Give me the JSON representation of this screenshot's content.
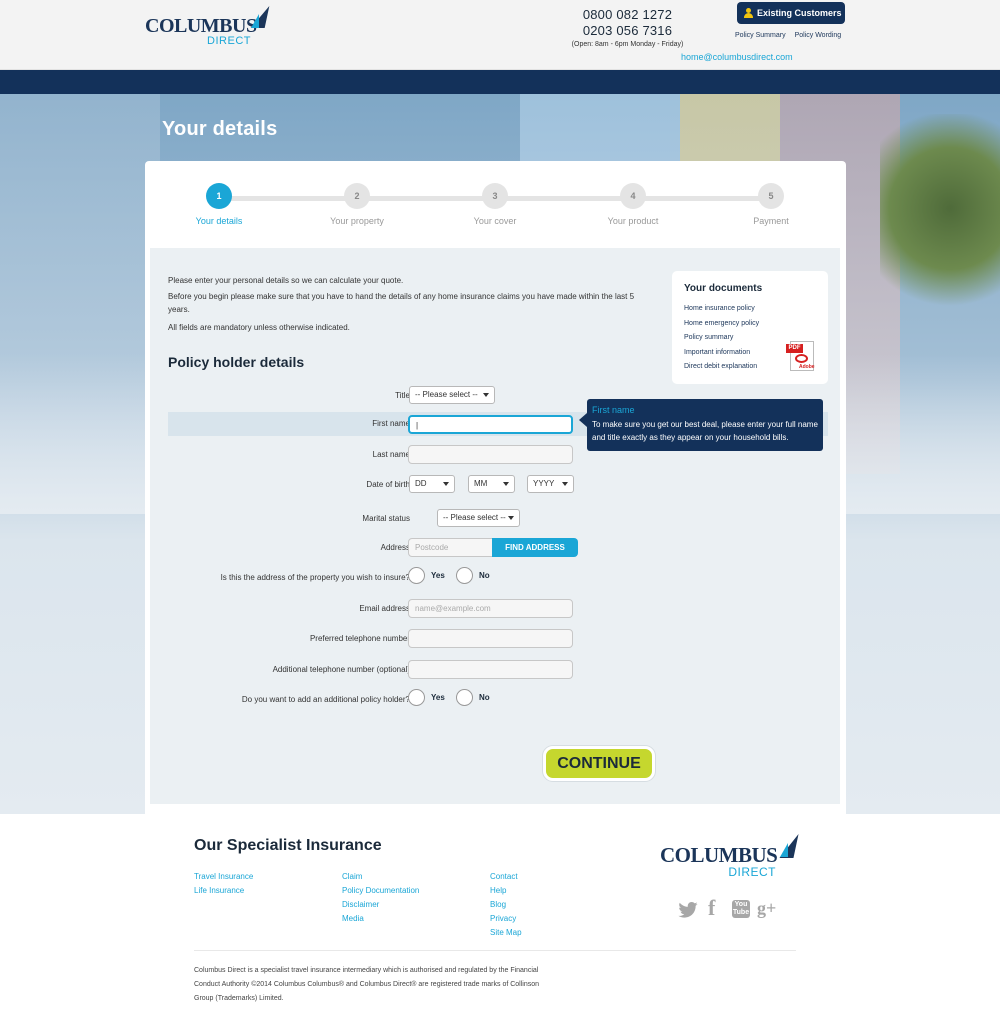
{
  "header": {
    "logo_main": "COLUMBUS",
    "logo_sub": "DIRECT",
    "phone1": "0800 082 1272",
    "phone2": "0203 056 7316",
    "hours": "(Open: 8am - 6pm Monday - Friday)",
    "existing_customers": "Existing Customers",
    "policy_summary": "Policy Summary",
    "policy_wording": "Policy Wording",
    "email": "home@columbusdirect.com"
  },
  "page_title": "Your details",
  "steps": [
    {
      "num": "1",
      "label": "Your details"
    },
    {
      "num": "2",
      "label": "Your property"
    },
    {
      "num": "3",
      "label": "Your cover"
    },
    {
      "num": "4",
      "label": "Your product"
    },
    {
      "num": "5",
      "label": "Payment"
    }
  ],
  "intro": {
    "line1": "Please enter your personal details so we can calculate your quote.",
    "line2": "Before you begin please make sure that you have to hand the details of any home insurance claims you have made within the last 5 years.",
    "line3": "All fields are mandatory unless otherwise indicated."
  },
  "documents": {
    "title": "Your documents",
    "items": [
      "Home insurance policy",
      "Home emergency policy",
      "Policy summary",
      "Important information",
      "Direct debit explanation"
    ],
    "pdf_tag": "PDF",
    "pdf_brand": "Adobe"
  },
  "form": {
    "section_title": "Policy holder details",
    "title_label": "Title",
    "title_value": "-- Please select --",
    "first_name_label": "First name",
    "first_name_value": "|",
    "last_name_label": "Last name",
    "dob_label": "Date of birth",
    "dob_dd": "DD",
    "dob_mm": "MM",
    "dob_yyyy": "YYYY",
    "marital_label": "Marital status",
    "marital_value": "-- Please select --",
    "address_label": "Address",
    "postcode_placeholder": "Postcode",
    "find_address": "FIND ADDRESS",
    "property_question": "Is this the address of the property you wish to insure?",
    "email_label": "Email address",
    "email_placeholder": "name@example.com",
    "tel_label": "Preferred telephone number",
    "tel2_label": "Additional telephone number (optional)",
    "additional_holder_question": "Do you want to add an additional policy holder?",
    "yes": "Yes",
    "no": "No",
    "continue": "CONTINUE"
  },
  "tooltip": {
    "title": "First name",
    "body": "To make sure you get our best deal, please enter your full name and title exactly as they appear on your household bills."
  },
  "footer": {
    "title": "Our Specialist Insurance",
    "col1": [
      "Travel Insurance",
      "Life Insurance"
    ],
    "col2": [
      "Claim",
      "Policy Documentation",
      "Disclaimer",
      "Media"
    ],
    "col3": [
      "Contact",
      "Help",
      "Blog",
      "Privacy",
      "Site Map"
    ],
    "social": {
      "twitter": "twitter-icon",
      "facebook": "f",
      "youtube": "You Tube",
      "gplus": "g+"
    },
    "legal": "Columbus Direct is a specialist travel insurance intermediary which is authorised and regulated by the Financial Conduct Authority ©2014 Columbus Columbus® and Columbus Direct® are registered trade marks of Collinson Group (Trademarks) Limited."
  },
  "colors": {
    "navy": "#13315a",
    "accent_blue": "#1aa6d6",
    "continue_green": "#c5d72e"
  }
}
